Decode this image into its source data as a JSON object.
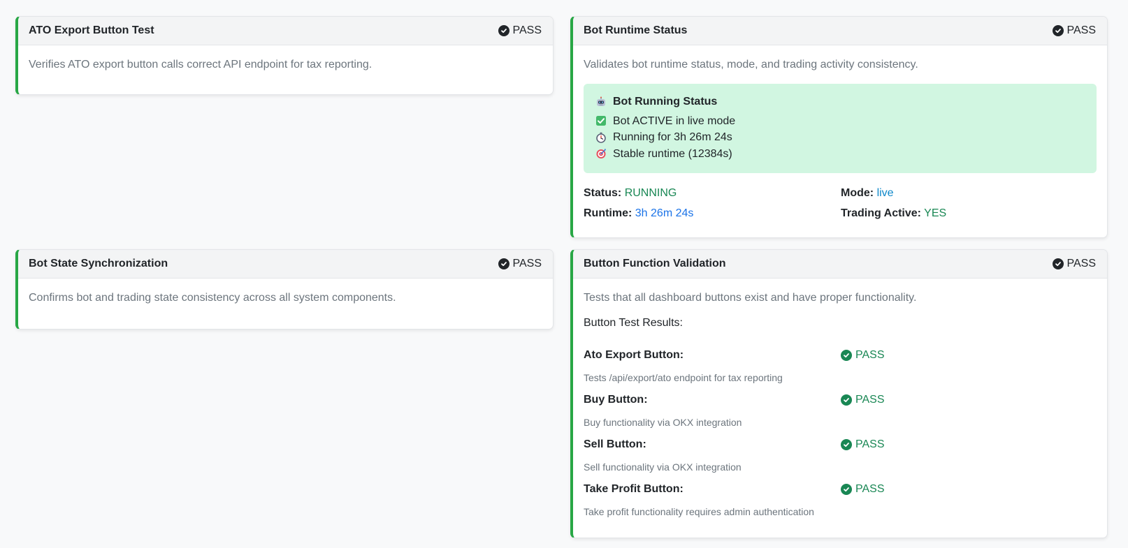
{
  "cards": {
    "ato_export": {
      "title": "ATO Export Button Test",
      "status": "PASS",
      "description": "Verifies ATO export button calls correct API endpoint for tax reporting."
    },
    "bot_runtime": {
      "title": "Bot Runtime Status",
      "status": "PASS",
      "description": "Validates bot runtime status, mode, and trading activity consistency.",
      "alert": {
        "title": "Bot Running Status",
        "line1": "Bot ACTIVE in live mode",
        "line2": "Running for 3h 26m 24s",
        "line3": "Stable runtime (12384s)"
      },
      "stats": {
        "status_label": "Status:",
        "status_value": "RUNNING",
        "mode_label": "Mode:",
        "mode_value": "live",
        "runtime_label": "Runtime:",
        "runtime_value": "3h 26m 24s",
        "trading_label": "Trading Active:",
        "trading_value": "YES"
      }
    },
    "bot_state": {
      "title": "Bot State Synchronization",
      "status": "PASS",
      "description": "Confirms bot and trading state consistency across all system components."
    },
    "button_validation": {
      "title": "Button Function Validation",
      "status": "PASS",
      "description": "Tests that all dashboard buttons exist and have proper functionality.",
      "results_heading": "Button Test Results:",
      "buttons": [
        {
          "name": "Ato Export Button:",
          "status": "PASS",
          "note": "Tests /api/export/ato endpoint for tax reporting"
        },
        {
          "name": "Buy Button:",
          "status": "PASS",
          "note": "Buy functionality via OKX integration"
        },
        {
          "name": "Sell Button:",
          "status": "PASS",
          "note": "Sell functionality via OKX integration"
        },
        {
          "name": "Take Profit Button:",
          "status": "PASS",
          "note": "Take profit functionality requires admin authentication"
        }
      ]
    }
  },
  "icons": {
    "pass": "check-circle-icon",
    "alert_title": "robot-icon",
    "alert_line1": "check-box-icon",
    "alert_line2": "stopwatch-icon",
    "alert_line3": "target-icon"
  },
  "colors": {
    "accent": "#28a745",
    "success_text": "#198754",
    "alert_bg": "#d1f6e1",
    "runtime_blue": "#1a73e8",
    "mode_blue": "#0d87c9"
  }
}
